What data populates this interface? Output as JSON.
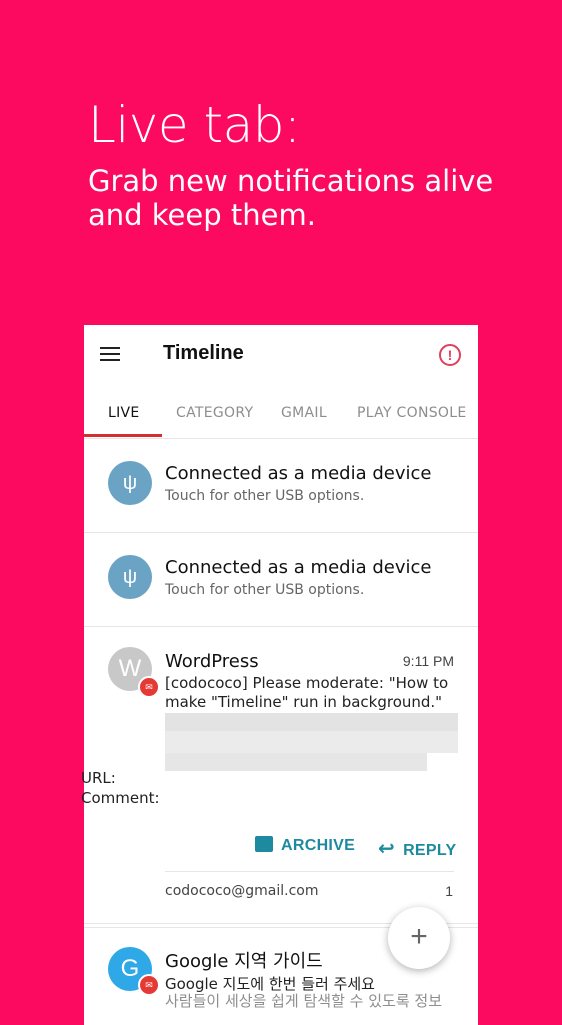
{
  "promo": {
    "title": "Live tab:",
    "subtitle": "Grab new notifications alive and keep them."
  },
  "toolbar": {
    "title": "Timeline",
    "alert_icon": "!"
  },
  "tabs": [
    {
      "label": "LIVE",
      "active": true
    },
    {
      "label": "CATEGORY",
      "active": false
    },
    {
      "label": "GMAIL",
      "active": false
    },
    {
      "label": "PLAY CONSOLE",
      "active": false
    }
  ],
  "usb_notifications": [
    {
      "title": "Connected as a media device",
      "subtitle": "Touch for other USB options.",
      "icon": "usb-icon"
    },
    {
      "title": "Connected as a media device",
      "subtitle": "Touch for other USB options.",
      "icon": "usb-icon"
    }
  ],
  "mail": {
    "avatar_letter": "W",
    "sender": "WordPress",
    "time": "9:11 PM",
    "body": "[codococo] Please moderate: \"How to make \"Timeline\" run in background.\"",
    "url_label": "URL:",
    "comment_label": "Comment:",
    "archive_label": "ARCHIVE",
    "reply_label": "REPLY",
    "account": "codococo@gmail.com",
    "count": "1"
  },
  "mail2": {
    "avatar_letter": "G",
    "sender": "Google 지역 가이드",
    "preview": "Google 지도에 한번 들러 주세요",
    "preview2": "사람들이 세상을 쉽게 탐색할 수 있도록 정보"
  },
  "fab": {
    "label": "+"
  },
  "colors": {
    "background": "#fb0a5f",
    "accent": "#1e8aa0",
    "indicator": "#d32f2f"
  }
}
